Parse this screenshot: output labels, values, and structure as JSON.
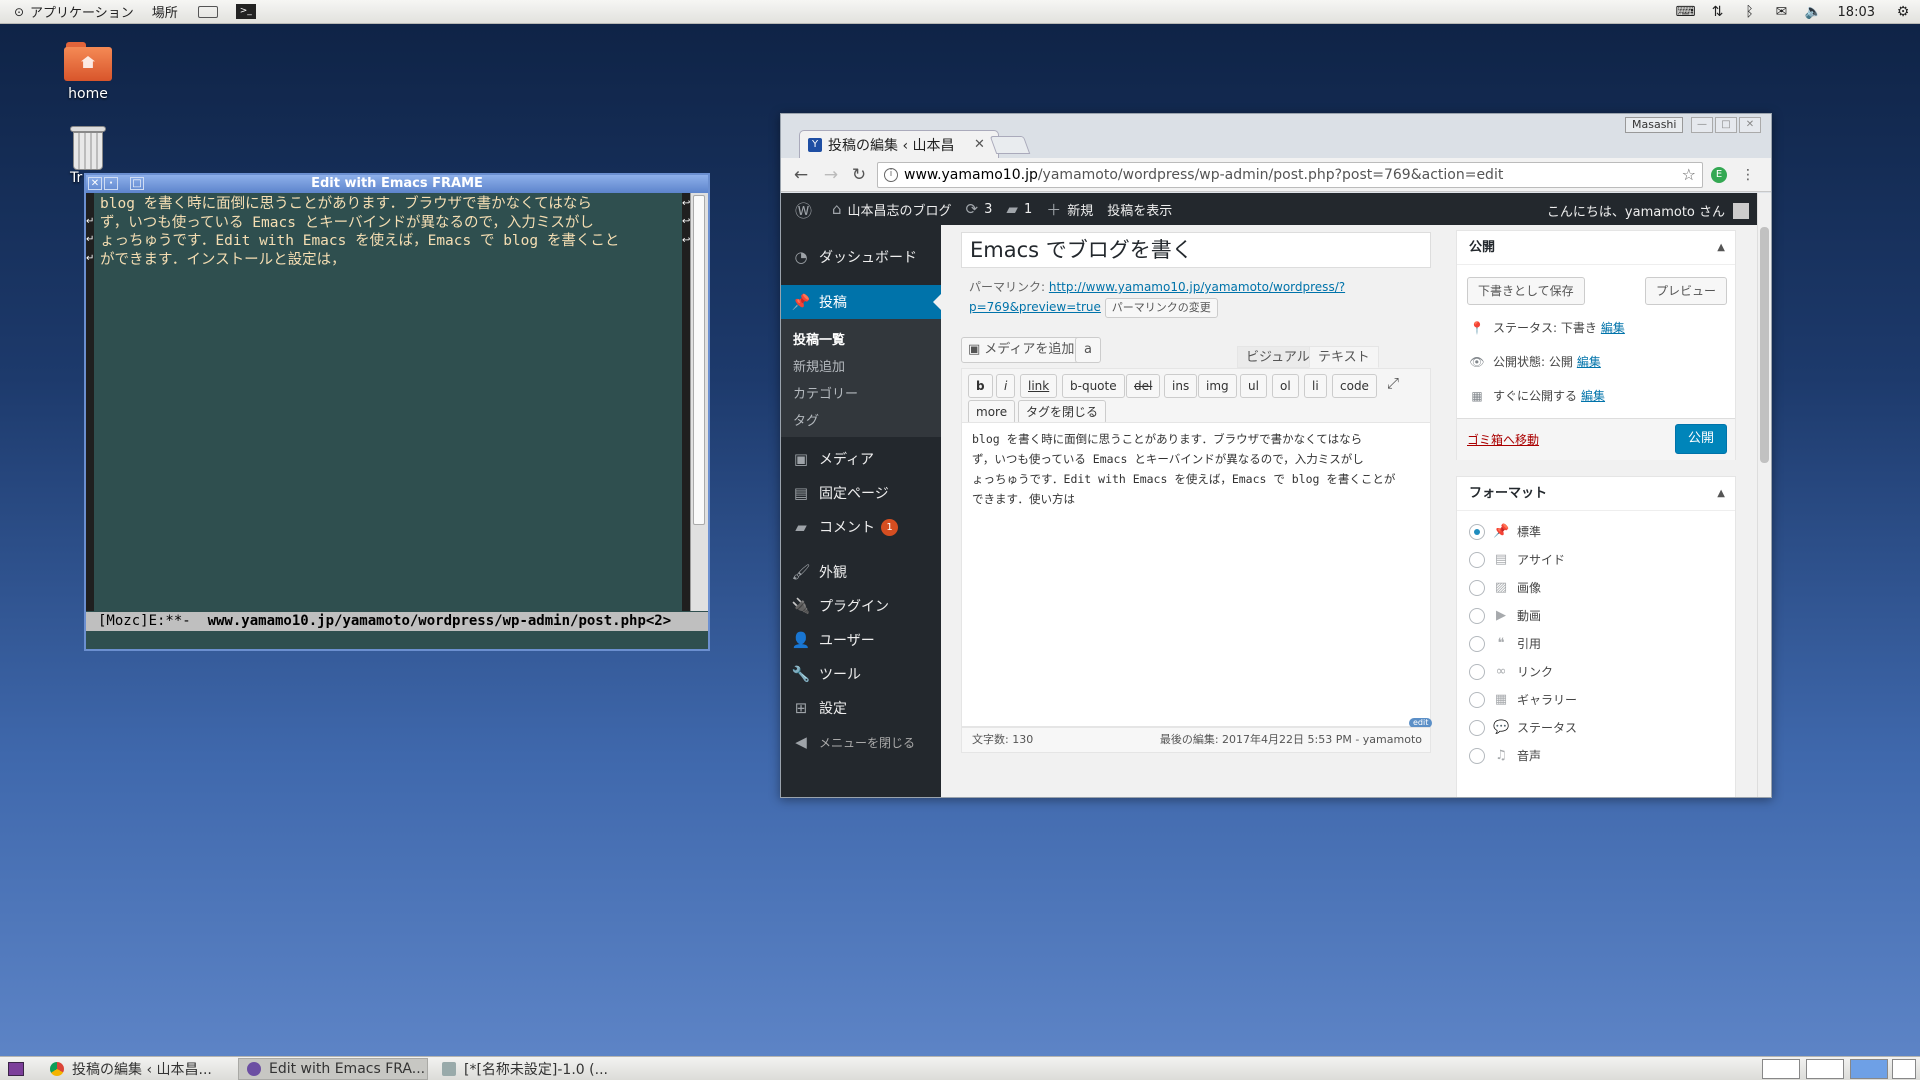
{
  "top_panel": {
    "apps_menu": "アプリケーション",
    "places_menu": "場所",
    "clock": "18:03"
  },
  "desktop": {
    "home_label": "home",
    "trash_label": "Tr"
  },
  "emacs": {
    "title": "Edit with Emacs FRAME",
    "lines": [
      "blog を書く時に面倒に思うことがあります．ブラウザで書かなくてはなら",
      "ず，いつも使っている Emacs とキーバインドが異なるので，入力ミスがし",
      "ょっちゅうです．Edit with Emacs を使えば，Emacs で blog を書くこと",
      "ができます．インストールと設定は，"
    ],
    "modeline_state": "[Mozc]E:**-  ",
    "modeline_buffer": "www.yamamo10.jp/yamamoto/wordpress/wp-admin/post.php<2>"
  },
  "chrome": {
    "tab_title": "投稿の編集 ‹ 山本昌",
    "profile": "Masashi",
    "url_host": "www.yamamo10.jp",
    "url_path": "/yamamoto/wordpress/wp-admin/post.php?post=769&action=edit"
  },
  "wp": {
    "adminbar": {
      "site_name": "山本昌志のブログ",
      "updates": "3",
      "comments": "1",
      "new": "新規",
      "view_post": "投稿を表示",
      "howdy": "こんにちは、yamamoto さん"
    },
    "menu": {
      "dashboard": "ダッシュボード",
      "posts": "投稿",
      "sub_all_posts": "投稿一覧",
      "sub_add_new": "新規追加",
      "sub_categories": "カテゴリー",
      "sub_tags": "タグ",
      "media": "メディア",
      "pages": "固定ページ",
      "comments": "コメント",
      "comments_badge": "1",
      "appearance": "外観",
      "plugins": "プラグイン",
      "users": "ユーザー",
      "tools": "ツール",
      "settings": "設定",
      "collapse": "メニューを閉じる"
    },
    "editor": {
      "post_title": "Emacs でブログを書く",
      "permalink_label": "パーマリンク:",
      "permalink_url_1": "http://www.yamamo10.jp/yamamoto/wordpress/?",
      "permalink_url_2": "p=769&preview=true",
      "permalink_change": "パーマリンクの変更",
      "add_media": "メディアを追加",
      "amazon": "a",
      "tab_visual": "ビジュアル",
      "tab_text": "テキスト",
      "qt_buttons": [
        "b",
        "i",
        "link",
        "b-quote",
        "del",
        "ins",
        "img",
        "ul",
        "ol",
        "li",
        "code",
        "more",
        "タグを閉じる"
      ],
      "content_lines": [
        "blog を書く時に面倒に思うことがあります．ブラウザで書かなくてはなら",
        "ず，いつも使っている Emacs とキーバインドが異なるので，入力ミスがし",
        "ょっちゅうです．Edit with Emacs を使えば，Emacs で blog を書くことが",
        "できます．使い方は"
      ],
      "edit_badge": "edit",
      "word_count": "文字数: 130",
      "last_edit": "最後の編集: 2017年4月22日 5:53 PM - yamamoto"
    },
    "publish_box": {
      "title": "公開",
      "save_draft": "下書きとして保存",
      "preview": "プレビュー",
      "status": "ステータス: 下書き",
      "visibility": "公開状態: 公開",
      "schedule": "すぐに公開する",
      "edit_link": "編集",
      "trash": "ゴミ箱へ移動",
      "publish": "公開"
    },
    "format_box": {
      "title": "フォーマット",
      "options": [
        "標準",
        "アサイド",
        "画像",
        "動画",
        "引用",
        "リンク",
        "ギャラリー",
        "ステータス",
        "音声"
      ]
    }
  },
  "taskbar": {
    "tasks": [
      "投稿の編集 ‹ 山本昌...",
      "Edit with Emacs FRA...",
      "[*[名称未設定]-1.0 (..."
    ]
  }
}
